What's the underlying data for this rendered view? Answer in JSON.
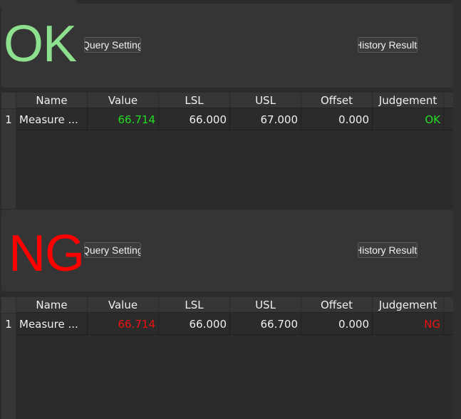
{
  "colors": {
    "ok": "#8de08d",
    "ok_cell": "#22dd22",
    "ng": "#ff0000",
    "ng_cell": "#ee1111"
  },
  "panels": [
    {
      "result_text": "OK",
      "query_button": "Query Setting",
      "history_button": "History Result",
      "table": {
        "columns": [
          "Name",
          "Value",
          "LSL",
          "USL",
          "Offset",
          "Judgement"
        ],
        "rows": [
          {
            "index": "1",
            "name": "Measure ...",
            "value": "66.714",
            "lsl": "66.000",
            "usl": "67.000",
            "offset": "0.000",
            "judgement": "OK"
          }
        ]
      }
    },
    {
      "result_text": "NG",
      "query_button": "Query Setting",
      "history_button": "History Result",
      "table": {
        "columns": [
          "Name",
          "Value",
          "LSL",
          "USL",
          "Offset",
          "Judgement"
        ],
        "rows": [
          {
            "index": "1",
            "name": "Measure ...",
            "value": "66.714",
            "lsl": "66.000",
            "usl": "66.700",
            "offset": "0.000",
            "judgement": "NG"
          }
        ]
      }
    }
  ]
}
